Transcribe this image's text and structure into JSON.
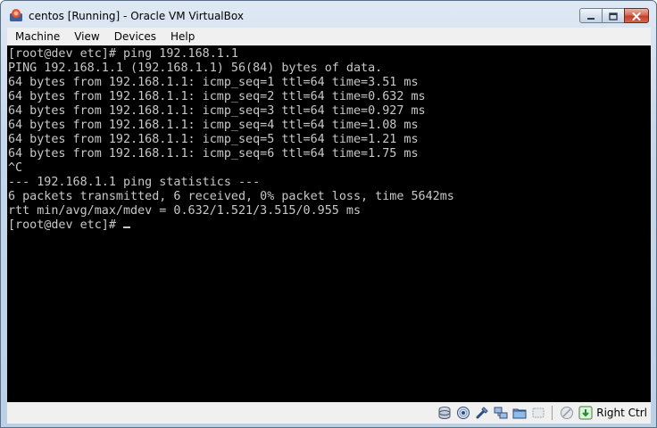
{
  "window": {
    "title": "centos [Running] - Oracle VM VirtualBox"
  },
  "menu": {
    "items": [
      "Machine",
      "View",
      "Devices",
      "Help"
    ]
  },
  "console": {
    "lines": [
      "[root@dev etc]# ping 192.168.1.1",
      "PING 192.168.1.1 (192.168.1.1) 56(84) bytes of data.",
      "64 bytes from 192.168.1.1: icmp_seq=1 ttl=64 time=3.51 ms",
      "64 bytes from 192.168.1.1: icmp_seq=2 ttl=64 time=0.632 ms",
      "64 bytes from 192.168.1.1: icmp_seq=3 ttl=64 time=0.927 ms",
      "64 bytes from 192.168.1.1: icmp_seq=4 ttl=64 time=1.08 ms",
      "64 bytes from 192.168.1.1: icmp_seq=5 ttl=64 time=1.21 ms",
      "64 bytes from 192.168.1.1: icmp_seq=6 ttl=64 time=1.75 ms",
      "^C",
      "--- 192.168.1.1 ping statistics ---",
      "6 packets transmitted, 6 received, 0% packet loss, time 5642ms",
      "rtt min/avg/max/mdev = 0.632/1.521/3.515/0.955 ms"
    ],
    "prompt": "[root@dev etc]# ",
    "text_color": "#c8c8c8",
    "background_color": "#000000"
  },
  "statusbar": {
    "icons": [
      "hard-disk-icon",
      "optical-drive-icon",
      "usb-icon",
      "network-icon",
      "shared-folders-icon",
      "video-capture-icon",
      "mouse-integration-icon",
      "host-key-icon"
    ],
    "host_key_label": "Right Ctrl"
  }
}
